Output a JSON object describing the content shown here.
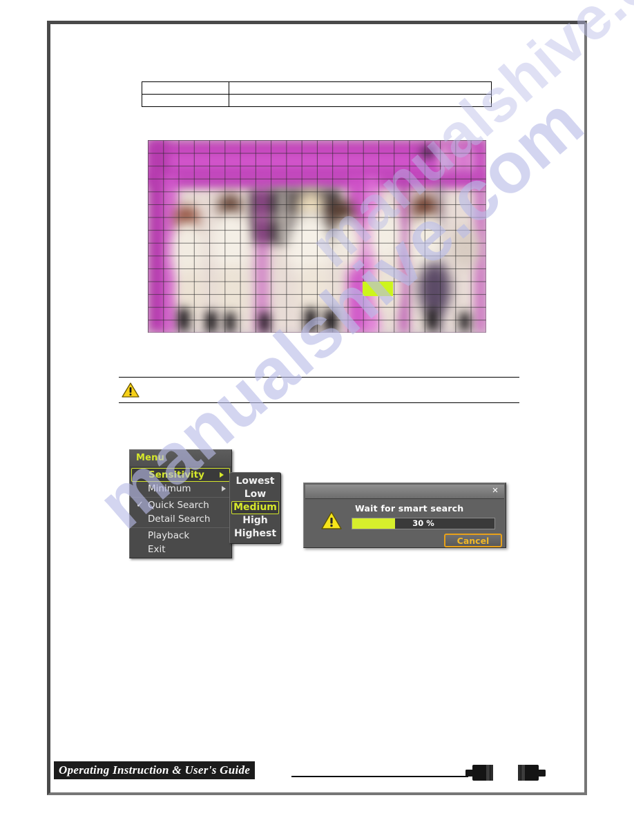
{
  "document": {
    "footer_title": "Operating Instruction & User's Guide",
    "watermark": "manualshive.com"
  },
  "spec_table": {
    "rows": [
      {
        "label": "",
        "value": ""
      },
      {
        "label": "",
        "value": ""
      }
    ]
  },
  "video_preview": {
    "caption": "",
    "grid": {
      "columns": 22,
      "rows": 15
    },
    "active_cell_color": "#cdf51c",
    "tint_color": "#c94fc0"
  },
  "note": {
    "icon": "warning-triangle-icon",
    "text": ""
  },
  "osd_menu": {
    "title": "Menu",
    "groups": [
      {
        "items": [
          {
            "label": "Sensitivity",
            "selected": true,
            "submenu": true,
            "checked": false
          },
          {
            "label": "Minimum",
            "selected": false,
            "submenu": true,
            "checked": false
          }
        ]
      },
      {
        "items": [
          {
            "label": "Quick Search",
            "selected": false,
            "submenu": false,
            "checked": true
          },
          {
            "label": "Detail Search",
            "selected": false,
            "submenu": false,
            "checked": false
          }
        ]
      },
      {
        "items": [
          {
            "label": "Playback",
            "selected": false,
            "submenu": false,
            "checked": false
          },
          {
            "label": "Exit",
            "selected": false,
            "submenu": false,
            "checked": false
          }
        ]
      }
    ],
    "accent_color": "#d6e82b"
  },
  "osd_submenu": {
    "items": [
      {
        "label": "Lowest",
        "selected": false
      },
      {
        "label": "Low",
        "selected": false
      },
      {
        "label": "Medium",
        "selected": true
      },
      {
        "label": "High",
        "selected": false
      },
      {
        "label": "Highest",
        "selected": false
      }
    ]
  },
  "progress_dialog": {
    "close_label": "×",
    "icon": "warning-triangle-icon",
    "message": "Wait for smart search",
    "progress_percent": 30,
    "progress_label": "30 %",
    "cancel_label": "Cancel",
    "fill_color": "#d6ef2c",
    "button_accent": "#f0b727"
  }
}
